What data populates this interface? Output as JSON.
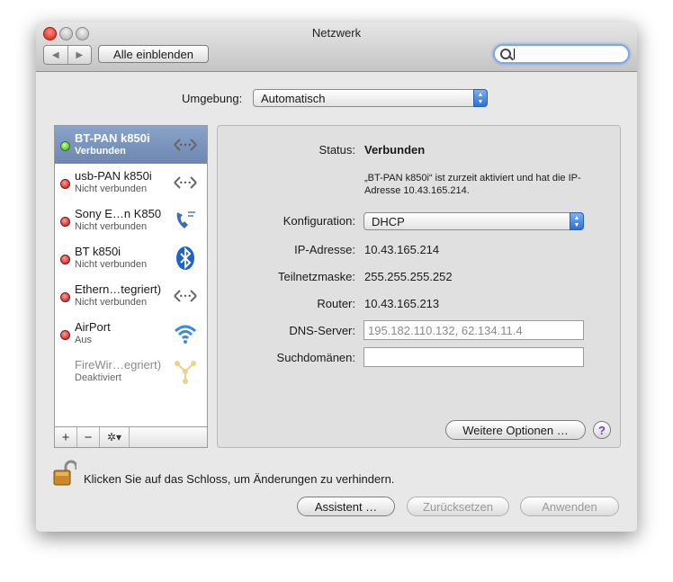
{
  "window": {
    "title": "Netzwerk",
    "show_all_label": "Alle einblenden",
    "search_placeholder": ""
  },
  "location": {
    "label": "Umgebung:",
    "value": "Automatisch"
  },
  "services": [
    {
      "name": "BT-PAN k850i",
      "status": "Verbunden",
      "state": "green",
      "icon": "modem-arrows-icon",
      "selected": true
    },
    {
      "name": "usb-PAN k850i",
      "status": "Nicht verbunden",
      "state": "red",
      "icon": "modem-arrows-icon"
    },
    {
      "name": "Sony E…n K850",
      "status": "Nicht verbunden",
      "state": "red",
      "icon": "phone-icon"
    },
    {
      "name": "BT k850i",
      "status": "Nicht verbunden",
      "state": "red",
      "icon": "bluetooth-icon"
    },
    {
      "name": "Ethern…tegriert)",
      "status": "Nicht verbunden",
      "state": "red",
      "icon": "ethernet-arrows-icon"
    },
    {
      "name": "AirPort",
      "status": "Aus",
      "state": "red",
      "icon": "wifi-icon"
    },
    {
      "name": "FireWir…egriert)",
      "status": "Deaktiviert",
      "state": "none",
      "icon": "firewire-icon"
    }
  ],
  "sidebar_buttons": {
    "add": "+",
    "remove": "−",
    "gear": "✲▾"
  },
  "detail": {
    "status_label": "Status:",
    "status_value": "Verbunden",
    "status_desc_line1": "„BT-PAN k850i“ ist zurzeit aktiviert und hat die IP-",
    "status_desc_line2": "Adresse 10.43.165.214.",
    "config_label": "Konfiguration:",
    "config_value": "DHCP",
    "ip_label": "IP-Adresse:",
    "ip_value": "10.43.165.214",
    "mask_label": "Teilnetzmaske:",
    "mask_value": "255.255.255.252",
    "router_label": "Router:",
    "router_value": "10.43.165.213",
    "dns_label": "DNS-Server:",
    "dns_value": "195.182.110.132, 62.134.11.4",
    "search_domains_label": "Suchdomänen:",
    "search_domains_value": "",
    "more_options_label": "Weitere Optionen …",
    "help_label": "?"
  },
  "footer": {
    "lock_text": "Klicken Sie auf das Schloss, um Änderungen zu verhindern.",
    "assistant_label": "Assistent …",
    "revert_label": "Zurücksetzen",
    "apply_label": "Anwenden"
  },
  "colors": {
    "accent": "#2d6fd6",
    "selection": "#7b93bb",
    "connected": "#3ea51a",
    "disconnected": "#c0120e"
  }
}
